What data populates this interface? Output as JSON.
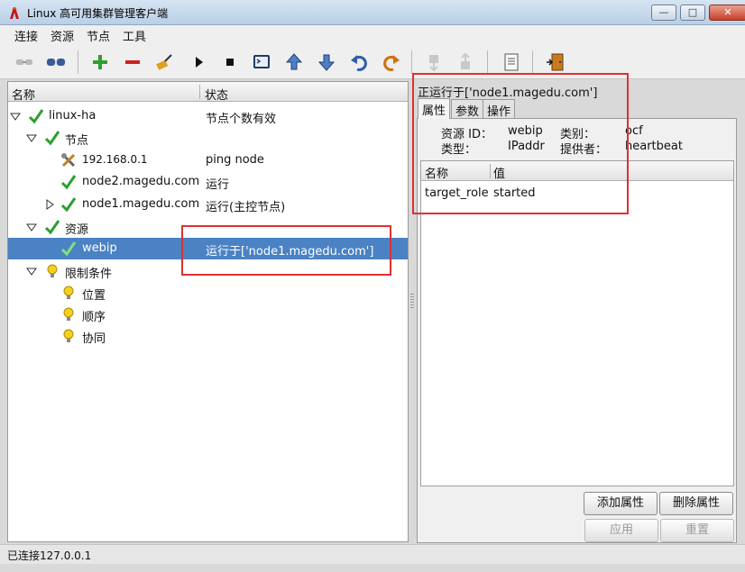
{
  "window": {
    "title": "Linux 高可用集群管理客户端",
    "min": "—",
    "max": "□",
    "close": "✕"
  },
  "menu": [
    "连接",
    "资源",
    "节点",
    "工具"
  ],
  "tree": {
    "col_name": "名称",
    "col_status": "状态",
    "rows": [
      {
        "label": "linux-ha",
        "status": "节点个数有效"
      },
      {
        "label": "节点",
        "status": ""
      },
      {
        "label": "192.168.0.1",
        "status": "ping node"
      },
      {
        "label": "node2.magedu.com",
        "status": "运行"
      },
      {
        "label": "node1.magedu.com",
        "status": "运行(主控节点)"
      },
      {
        "label": "资源",
        "status": ""
      },
      {
        "label": "webip",
        "status": "运行于['node1.magedu.com']"
      },
      {
        "label": "限制条件",
        "status": ""
      },
      {
        "label": "位置",
        "status": ""
      },
      {
        "label": "顺序",
        "status": ""
      },
      {
        "label": "协同",
        "status": ""
      }
    ]
  },
  "detail": {
    "title": "正运行于['node1.magedu.com']",
    "tabs": [
      "属性",
      "参数",
      "操作"
    ],
    "info": {
      "id_label": "资源 ID：",
      "id_value": "webip",
      "class_label": "类别：",
      "class_value": "ocf",
      "type_label": "类型：",
      "type_value": "IPaddr",
      "provider_label": "提供者：",
      "provider_value": "heartbeat"
    },
    "table": {
      "col_name": "名称",
      "col_value": "值",
      "rows": [
        {
          "name": "target_role",
          "value": "started"
        }
      ]
    },
    "add_attr": "添加属性",
    "del_attr": "删除属性",
    "apply": "应用",
    "reset": "重置"
  },
  "status": "已连接127.0.0.1",
  "colors": {
    "selection": "#4a82c3",
    "check": "#2e9e2e",
    "highlight": "#e03030"
  }
}
